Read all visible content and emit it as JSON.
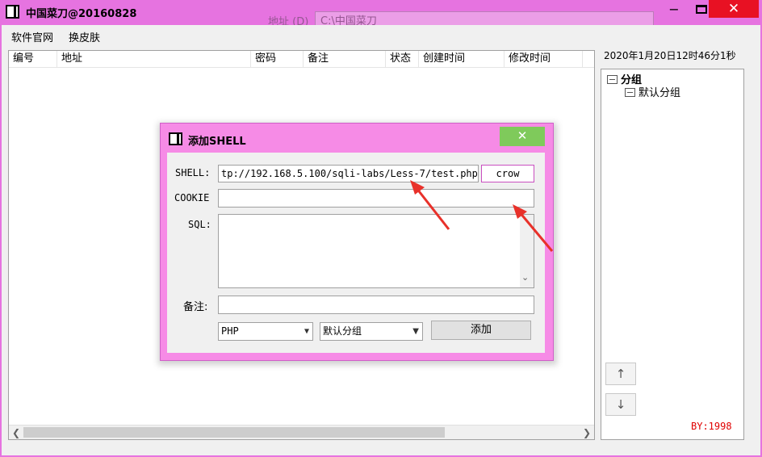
{
  "window": {
    "title": "中国菜刀@20160828",
    "minimize": "−",
    "close": "✕"
  },
  "background_window": {
    "address_label": "地址 (D)",
    "address_value": "C:\\中国菜刀"
  },
  "menu": {
    "items": [
      "软件官网",
      "换皮肤"
    ]
  },
  "list": {
    "columns": [
      "编号",
      "地址",
      "密码",
      "备注",
      "状态",
      "创建时间",
      "修改时间"
    ]
  },
  "sidebar": {
    "clock": "2020年1月20日12时46分1秒",
    "tree": {
      "root": "分组",
      "children": [
        "默认分组"
      ]
    },
    "up_button": "↑",
    "down_button": "↓",
    "by_label": "BY:1998"
  },
  "dialog": {
    "title": "添加SHELL",
    "close": "✕",
    "shell_label": "SHELL:",
    "shell_url": "tp://192.168.5.100/sqli-labs/Less-7/test.php",
    "shell_password": "crow",
    "cookie_label": "COOKIE",
    "cookie_value": "",
    "sql_label": "SQL:",
    "sql_value": "",
    "note_label": "备注:",
    "note_value": "",
    "script_type": "PHP",
    "group": "默认分组",
    "add_button": "添加"
  },
  "colors": {
    "skin": "#e673e0",
    "dialog_skin": "#f68be6",
    "dialog_close": "#7fca5b",
    "window_close": "#e81123",
    "annotation_arrow": "#e8312a",
    "by_label": "#e00000"
  }
}
